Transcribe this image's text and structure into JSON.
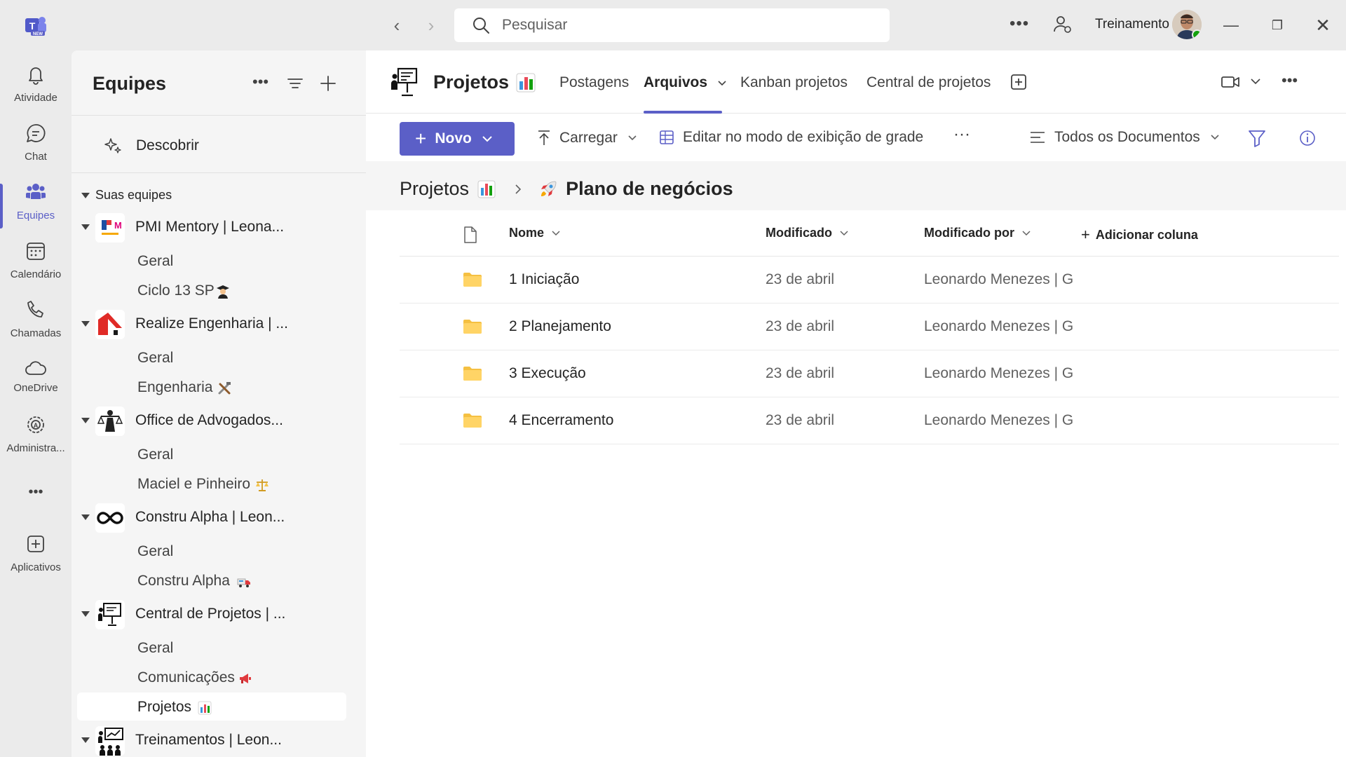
{
  "titlebar": {
    "search_placeholder": "Pesquisar",
    "user_name": "Treinamento"
  },
  "rail": {
    "items": [
      {
        "label": "Atividade",
        "icon": "bell-icon"
      },
      {
        "label": "Chat",
        "icon": "chat-icon"
      },
      {
        "label": "Equipes",
        "icon": "teams-icon",
        "active": true
      },
      {
        "label": "Calendário",
        "icon": "calendar-icon"
      },
      {
        "label": "Chamadas",
        "icon": "phone-icon"
      },
      {
        "label": "OneDrive",
        "icon": "cloud-icon"
      },
      {
        "label": "Administra...",
        "icon": "admin-icon"
      },
      {
        "label": "Aplicativos",
        "icon": "apps-add-icon"
      }
    ],
    "more_label": "•••"
  },
  "teams_panel": {
    "title": "Equipes",
    "discover_label": "Descobrir",
    "section_label": "Suas equipes",
    "teams": [
      {
        "name": "PMI Mentory | Leona...",
        "channels": [
          "Geral",
          "Ciclo 13 SP"
        ]
      },
      {
        "name": "Realize Engenharia | ...",
        "channels": [
          "Geral",
          "Engenharia"
        ]
      },
      {
        "name": "Office de Advogados...",
        "channels": [
          "Geral",
          "Maciel e Pinheiro"
        ]
      },
      {
        "name": "Constru Alpha | Leon...",
        "channels": [
          "Geral",
          "Constru Alpha"
        ]
      },
      {
        "name": "Central de Projetos | ...",
        "channels": [
          "Geral",
          "Comunicações",
          "Projetos"
        ]
      },
      {
        "name": "Treinamentos | Leon...",
        "channels": []
      }
    ]
  },
  "main": {
    "channel_title": "Projetos",
    "tabs": [
      "Postagens",
      "Arquivos",
      "Kanban projetos",
      "Central de projetos"
    ],
    "active_tab": "Arquivos",
    "toolbar": {
      "new_label": "Novo",
      "upload_label": "Carregar",
      "grid_label": "Editar no modo de exibição de grade",
      "more_label": "···",
      "view_label": "Todos os Documentos"
    },
    "breadcrumb": {
      "root": "Projetos",
      "current": "Plano de negócios"
    },
    "columns": {
      "name": "Nome",
      "modified": "Modificado",
      "modified_by": "Modificado por",
      "add_column": "Adicionar coluna"
    },
    "rows": [
      {
        "name": "1 Iniciação",
        "modified": "23 de abril",
        "modified_by": "Leonardo Menezes | G"
      },
      {
        "name": "2 Planejamento",
        "modified": "23 de abril",
        "modified_by": "Leonardo Menezes | G"
      },
      {
        "name": "3 Execução",
        "modified": "23 de abril",
        "modified_by": "Leonardo Menezes | G"
      },
      {
        "name": "4 Encerramento",
        "modified": "23 de abril",
        "modified_by": "Leonardo Menezes | G"
      }
    ]
  },
  "colors": {
    "accent": "#5b5fc7",
    "folder": "#f5c042",
    "bar_chart": [
      "#3a96dd",
      "#ea4a5a",
      "#13a10e"
    ]
  }
}
